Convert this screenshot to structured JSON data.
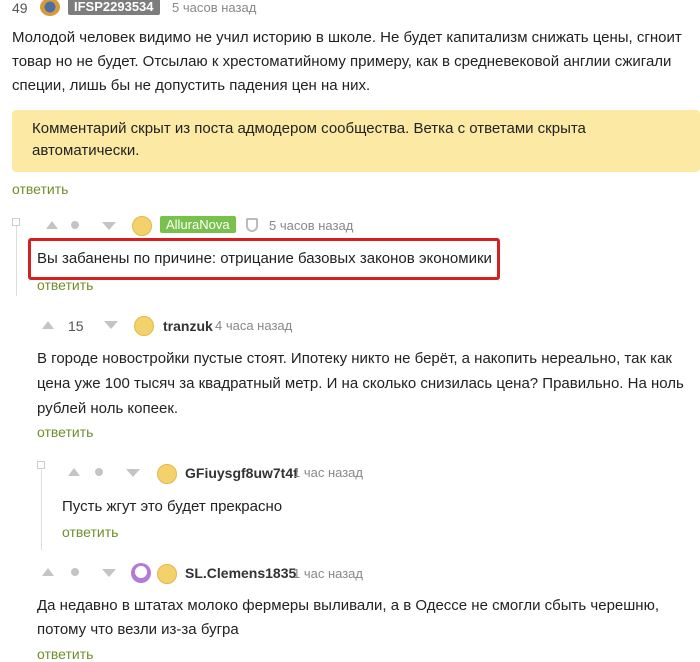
{
  "top": {
    "score": "49",
    "username": "IFSP2293534",
    "time": "5 часов назад"
  },
  "comment1": {
    "lines": [
      "Молодой человек видимо не учил историю в школе. Не будет капитализм снижать цены, сгноит",
      "товар но не будет. Отсылаю к хрестоматийному примеру, как в средневековой англии сжигали",
      "специи, лишь бы не допустить падения цен на них."
    ]
  },
  "notice": {
    "lines": [
      "Комментарий скрыт из поста адмодером сообщества. Ветка с ответами скрыта",
      "автоматически."
    ]
  },
  "reply_label": "ответить",
  "comment2": {
    "username": "AlluraNova",
    "time": "5 часов назад",
    "text": "Вы забанены по причине: отрицание базовых законов экономики"
  },
  "comment3": {
    "score": "15",
    "username": "tranzuk",
    "time": "4 часа назад",
    "lines": [
      "В городе новостройки пустые стоят. Ипотеку никто не берёт, а накопить нереально, так как",
      "цена уже 100 тысяч за квадратный метр. И на сколько снизилась цена? Правильно. На ноль",
      "рублей ноль копеек."
    ]
  },
  "comment4": {
    "username": "GFiuysgf8uw7t4f",
    "time": "1 час назад",
    "text": "Пусть жгут это будет прекрасно"
  },
  "comment5": {
    "username": "SL.Clemens1835",
    "time": "1 час назад",
    "lines": [
      "Да недавно в штатах молоко фермеры выливали, а в Одессе не смогли сбыть черешню,",
      "потому что везли из-за бугра"
    ]
  },
  "colors": {
    "accent_green": "#6f8f2e",
    "highlight_red": "#d42020",
    "notice_bg": "#fbe9a4"
  },
  "icons": [
    "vote-up-icon",
    "vote-down-icon",
    "shield-icon",
    "avatar-icon"
  ]
}
